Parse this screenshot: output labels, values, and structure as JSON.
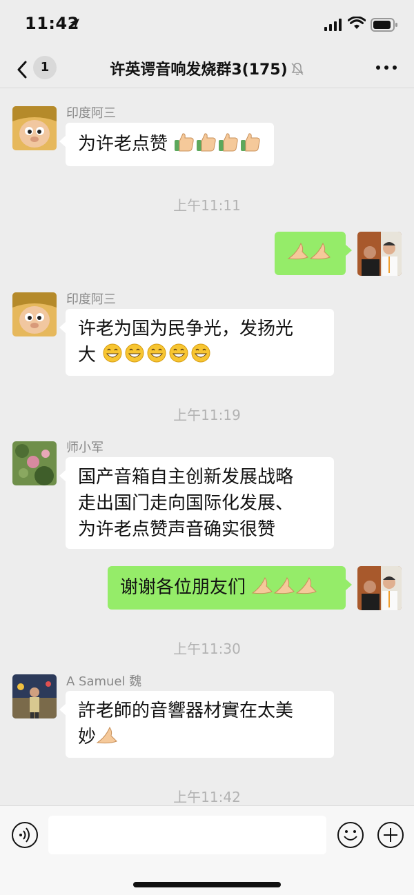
{
  "status_bar": {
    "time": "11:42"
  },
  "nav": {
    "unread_count": "1",
    "title": "许英谔音响发烧群3(175)"
  },
  "messages": [
    {
      "type": "in",
      "sender": "印度阿三",
      "text": "为许老点赞",
      "emoji": "thumbs-up",
      "emoji_count": 4
    },
    {
      "type": "time",
      "text": "上午11:11"
    },
    {
      "type": "out",
      "text": "",
      "emoji": "pinch-hand",
      "emoji_count": 2
    },
    {
      "type": "in",
      "sender": "印度阿三",
      "line1": "许老为国为民争光，发扬光",
      "line2": "大",
      "emoji": "grin",
      "emoji_count": 5
    },
    {
      "type": "time",
      "text": "上午11:19"
    },
    {
      "type": "in",
      "sender": "师小军",
      "line1": "国产音箱自主创新发展战略",
      "line2": "走出国门走向国际化发展、",
      "line3": "为许老点赞声音确实很赞"
    },
    {
      "type": "out",
      "text": "谢谢各位朋友们",
      "emoji": "pinch-hand",
      "emoji_count": 3
    },
    {
      "type": "time",
      "text": "上午11:30"
    },
    {
      "type": "in",
      "sender": "A Samuel 魏",
      "line1": "許老師的音響器材實在太美",
      "line2": "妙",
      "emoji": "pinch-hand",
      "emoji_count": 1
    },
    {
      "type": "time",
      "text": "上午11:42"
    }
  ],
  "input": {
    "placeholder": ""
  },
  "colors": {
    "bg": "#ededed",
    "out_bubble": "#95ec69",
    "in_bubble": "#ffffff",
    "meta": "#888888"
  }
}
